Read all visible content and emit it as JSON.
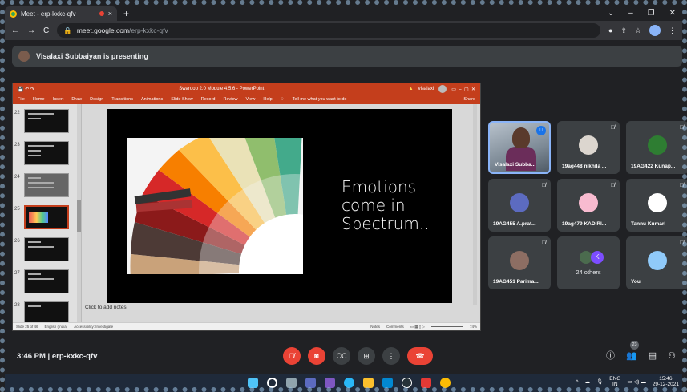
{
  "browser": {
    "tab_title": "Meet - erp-kxkc-qfv",
    "tab_close": "×",
    "new_tab": "+",
    "win_min": "⌄",
    "win_min2": "–",
    "win_max": "❐",
    "win_close": "✕",
    "url_host": "meet.google.com",
    "url_path": "/erp-kxkc-qfv"
  },
  "banner": {
    "text": "Visalaxi Subbaiyan is presenting"
  },
  "ppt": {
    "title": "Swaroop 2.0 Module 4.5.6  -  PowerPoint",
    "user": "visalaxi",
    "tell_me": "Tell me what you want to do",
    "share": "Share",
    "menu": [
      "File",
      "Home",
      "Insert",
      "Draw",
      "Design",
      "Transitions",
      "Animations",
      "Slide Show",
      "Record",
      "Review",
      "View",
      "Help"
    ],
    "thumbs": [
      "22",
      "23",
      "24",
      "25",
      "26",
      "27",
      "28"
    ],
    "slide_text": [
      "Emotions",
      "come in",
      "Spectrum.."
    ],
    "notes_placeholder": "Click to add notes",
    "status_left": "Slide 25 of 46",
    "status_lang": "English (India)",
    "status_access": "Accessibility: Investigate",
    "status_notes": "Notes",
    "status_comments": "Comments",
    "zoom": "74%"
  },
  "tiles": [
    {
      "name": "Visalaxi Subba...",
      "type": "video"
    },
    {
      "name": "19ag448 nikhila ...",
      "color": "#dcd6cf"
    },
    {
      "name": "19AG422 Kunap...",
      "color": "#2e7d32"
    },
    {
      "name": "19AG455 A.prat...",
      "color": "#5c6bc0"
    },
    {
      "name": "19ag479 KADIRI...",
      "color": "#f8bbd0"
    },
    {
      "name": "Tannu Kumari",
      "color": "#ffffff"
    },
    {
      "name": "19AG451 Parima...",
      "color": "#8d6e63"
    },
    {
      "name": "24 others",
      "type": "others",
      "letter": "K"
    },
    {
      "name": "You",
      "color": "#90caf9"
    }
  ],
  "meet": {
    "time": "3:46 PM",
    "sep": "|",
    "code": "erp-kxkc-qfv",
    "people_count": "23"
  },
  "taskbar": {
    "lang_top": "ENG",
    "lang_bottom": "IN",
    "time": "15:46",
    "date": "29-12-2021"
  }
}
